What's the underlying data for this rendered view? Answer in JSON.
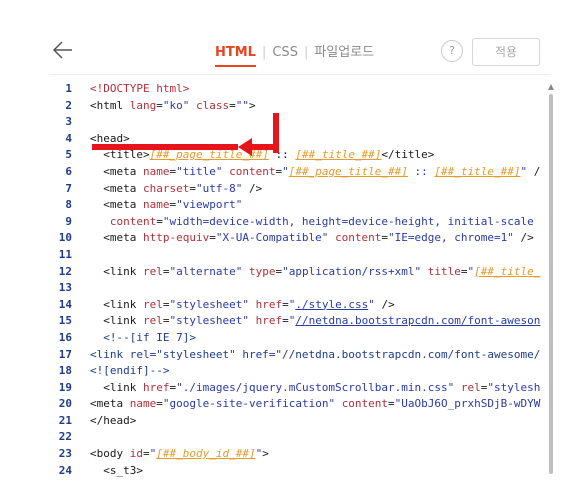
{
  "header": {
    "back_icon": "arrow-left-icon",
    "tabs": [
      {
        "label": "HTML",
        "active": true
      },
      {
        "label": "CSS",
        "active": false
      },
      {
        "label": "파일업로드",
        "active": false
      }
    ],
    "help_label": "?",
    "apply_label": "적용"
  },
  "colors": {
    "accent": "#e8441f",
    "annotation_arrow": "#e8141c"
  },
  "editor": {
    "lines": [
      {
        "n": "1",
        "segs": [
          [
            "doc",
            "<!DOCTYPE html>"
          ]
        ]
      },
      {
        "n": "2",
        "segs": [
          [
            "tag",
            "<html "
          ],
          [
            "attr",
            "lang"
          ],
          [
            "tag",
            "="
          ],
          [
            "val",
            "\"ko\""
          ],
          [
            "tag",
            " "
          ],
          [
            "attr",
            "class"
          ],
          [
            "tag",
            "="
          ],
          [
            "val",
            "\"\""
          ],
          [
            "tag",
            ">"
          ]
        ]
      },
      {
        "n": "3",
        "segs": []
      },
      {
        "n": "4",
        "segs": [
          [
            "tag",
            "<head>"
          ]
        ]
      },
      {
        "n": "5",
        "segs": [
          [
            "tag",
            "  <title>"
          ],
          [
            "var",
            "[##_page_title_##]"
          ],
          [
            "tag",
            " :: "
          ],
          [
            "var",
            "[##_title_##]"
          ],
          [
            "tag",
            "</title>"
          ]
        ]
      },
      {
        "n": "6",
        "segs": [
          [
            "tag",
            "  <meta "
          ],
          [
            "attr",
            "name"
          ],
          [
            "tag",
            "="
          ],
          [
            "val",
            "\"title\""
          ],
          [
            "tag",
            " "
          ],
          [
            "attr",
            "content"
          ],
          [
            "tag",
            "="
          ],
          [
            "val",
            "\""
          ],
          [
            "var",
            "[##_page_title_##]"
          ],
          [
            "val",
            " :: "
          ],
          [
            "var",
            "[##_title_##]"
          ],
          [
            "val",
            "\""
          ],
          [
            "tag",
            " /"
          ]
        ]
      },
      {
        "n": "7",
        "segs": [
          [
            "tag",
            "  <meta "
          ],
          [
            "attr",
            "charset"
          ],
          [
            "tag",
            "="
          ],
          [
            "val",
            "\"utf-8\""
          ],
          [
            "tag",
            " />"
          ]
        ]
      },
      {
        "n": "8",
        "segs": [
          [
            "tag",
            "  <meta "
          ],
          [
            "attr",
            "name"
          ],
          [
            "tag",
            "="
          ],
          [
            "val",
            "\"viewport\""
          ]
        ]
      },
      {
        "n": "9",
        "segs": [
          [
            "tag",
            "   "
          ],
          [
            "attr",
            "content"
          ],
          [
            "tag",
            "="
          ],
          [
            "val",
            "\"width=device-width, height=device-height, initial-scale"
          ]
        ]
      },
      {
        "n": "10",
        "segs": [
          [
            "tag",
            "  <meta "
          ],
          [
            "attr",
            "http-equiv"
          ],
          [
            "tag",
            "="
          ],
          [
            "val",
            "\"X-UA-Compatible\""
          ],
          [
            "tag",
            " "
          ],
          [
            "attr",
            "content"
          ],
          [
            "tag",
            "="
          ],
          [
            "val",
            "\"IE=edge, chrome=1\""
          ],
          [
            "tag",
            " />"
          ]
        ]
      },
      {
        "n": "11",
        "segs": []
      },
      {
        "n": "12",
        "segs": [
          [
            "tag",
            "  <link "
          ],
          [
            "attr",
            "rel"
          ],
          [
            "tag",
            "="
          ],
          [
            "val",
            "\"alternate\""
          ],
          [
            "tag",
            " "
          ],
          [
            "attr",
            "type"
          ],
          [
            "tag",
            "="
          ],
          [
            "val",
            "\"application/rss+xml\""
          ],
          [
            "tag",
            " "
          ],
          [
            "attr",
            "title"
          ],
          [
            "tag",
            "="
          ],
          [
            "val",
            "\""
          ],
          [
            "var",
            "[##_title_"
          ]
        ]
      },
      {
        "n": "13",
        "segs": []
      },
      {
        "n": "14",
        "segs": [
          [
            "tag",
            "  <link "
          ],
          [
            "attr",
            "rel"
          ],
          [
            "tag",
            "="
          ],
          [
            "val",
            "\"stylesheet\""
          ],
          [
            "tag",
            " "
          ],
          [
            "attr",
            "href"
          ],
          [
            "tag",
            "="
          ],
          [
            "val",
            "\""
          ],
          [
            "link",
            "./style.css"
          ],
          [
            "val",
            "\""
          ],
          [
            "tag",
            " />"
          ]
        ]
      },
      {
        "n": "15",
        "segs": [
          [
            "tag",
            "  <link "
          ],
          [
            "attr",
            "rel"
          ],
          [
            "tag",
            "="
          ],
          [
            "val",
            "\"stylesheet\""
          ],
          [
            "tag",
            " "
          ],
          [
            "attr",
            "href"
          ],
          [
            "tag",
            "="
          ],
          [
            "val",
            "\""
          ],
          [
            "link",
            "//netdna.bootstrapcdn.com/font-aweson"
          ]
        ]
      },
      {
        "n": "16",
        "segs": [
          [
            "cmt",
            "  <!--[if IE 7]>"
          ]
        ]
      },
      {
        "n": "17",
        "segs": [
          [
            "cmt",
            "<link rel=\"stylesheet\" href=\"//netdna.bootstrapcdn.com/font-awesome/"
          ]
        ]
      },
      {
        "n": "18",
        "segs": [
          [
            "cmt",
            "<![endif]-->"
          ]
        ]
      },
      {
        "n": "19",
        "segs": [
          [
            "tag",
            "  <link "
          ],
          [
            "attr",
            "href"
          ],
          [
            "tag",
            "="
          ],
          [
            "val",
            "\"./images/jquery.mCustomScrollbar.min.css\""
          ],
          [
            "tag",
            " "
          ],
          [
            "attr",
            "rel"
          ],
          [
            "tag",
            "="
          ],
          [
            "val",
            "\"stylesh"
          ]
        ]
      },
      {
        "n": "20",
        "segs": [
          [
            "tag",
            "<meta "
          ],
          [
            "attr",
            "name"
          ],
          [
            "tag",
            "="
          ],
          [
            "val",
            "\"google-site-verification\""
          ],
          [
            "tag",
            " "
          ],
          [
            "attr",
            "content"
          ],
          [
            "tag",
            "="
          ],
          [
            "val",
            "\"UaObJ6O_prxhSDjB-wDYW"
          ]
        ]
      },
      {
        "n": "21",
        "segs": [
          [
            "tag",
            "</head>"
          ]
        ]
      },
      {
        "n": "22",
        "segs": []
      },
      {
        "n": "23",
        "segs": [
          [
            "tag",
            "<body "
          ],
          [
            "attr",
            "id"
          ],
          [
            "tag",
            "="
          ],
          [
            "val",
            "\""
          ],
          [
            "var",
            "[##_body_id_##]"
          ],
          [
            "val",
            "\""
          ],
          [
            "tag",
            ">"
          ]
        ]
      },
      {
        "n": "24",
        "segs": [
          [
            "tag",
            "  <s_t3>"
          ]
        ]
      }
    ]
  }
}
